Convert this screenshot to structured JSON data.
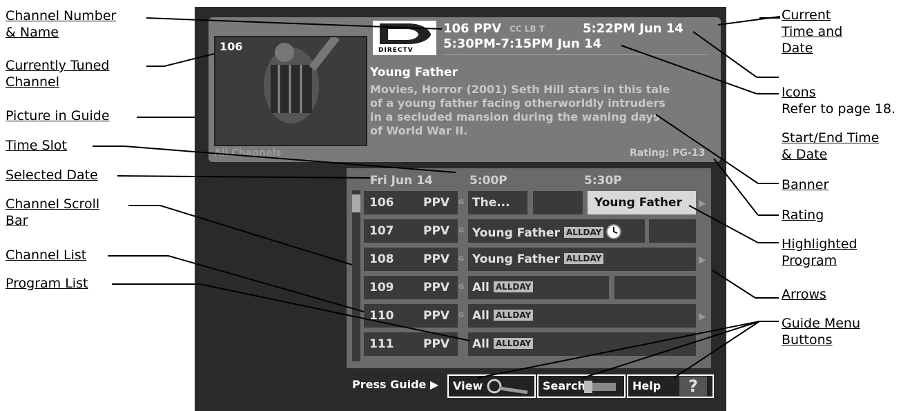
{
  "callouts": {
    "channel_number_name": [
      "Channel Number",
      "& Name"
    ],
    "currently_tuned": [
      "Currently Tuned",
      "Channel"
    ],
    "picture_in_guide": "Picture in Guide",
    "time_slot": "Time Slot",
    "selected_date": "Selected Date",
    "channel_scroll_bar": [
      "Channel Scroll ",
      "Bar"
    ],
    "channel_list": "Channel List",
    "program_list": "Program List",
    "current_time_date": [
      "Current",
      "Time and",
      "Date"
    ],
    "icons": "Icons",
    "icons_ref": "Refer to page 18.",
    "start_end": [
      "Start/End Time",
      "& Date"
    ],
    "banner": "Banner",
    "rating": "Rating",
    "highlighted_program": [
      "Highlighted ",
      "Program"
    ],
    "arrows": "Arrows",
    "guide_menu_buttons": [
      "Guide Menu ",
      "Buttons"
    ]
  },
  "banner": {
    "pip_channel": "106",
    "logo": "DIRECTV",
    "channel_line": "106 PPV",
    "icons_text": "CC LB T",
    "current_time": "5:22PM Jun 14",
    "start_end": "5:30PM-7:15PM Jun 14",
    "title": "Young Father",
    "description": "Movies, Horror (2001) Seth Hill stars in this tale of a young father facing otherworldly intruders in a secluded mansion during the waning days of World War II.",
    "category": "All Channels",
    "rating": "Rating: PG-13"
  },
  "grid": {
    "date": "Fri Jun 14",
    "slot1": "5:00P",
    "slot2": "5:30P",
    "rows": [
      {
        "num": "106",
        "net": "PPV",
        "g": "G",
        "prog": "The...",
        "highlight": "Young Father"
      },
      {
        "num": "107",
        "net": "PPV",
        "g": "G",
        "prog": "Young Father",
        "allday": "ALLDAY"
      },
      {
        "num": "108",
        "net": "PPV",
        "g": "G",
        "prog": "Young Father",
        "allday": "ALLDAY"
      },
      {
        "num": "109",
        "net": "PPV",
        "g": "G",
        "prog": "All",
        "allday": "ALLDAY"
      },
      {
        "num": "110",
        "net": "PPV",
        "g": "G",
        "prog": "All",
        "allday": "ALLDAY"
      },
      {
        "num": "111",
        "net": "PPV",
        "g": "",
        "prog": "All",
        "allday": "ALLDAY"
      }
    ]
  },
  "menu": {
    "press": "Press Guide ▶",
    "view": "View",
    "search": "Search",
    "help": "Help",
    "help_icon": "?"
  }
}
